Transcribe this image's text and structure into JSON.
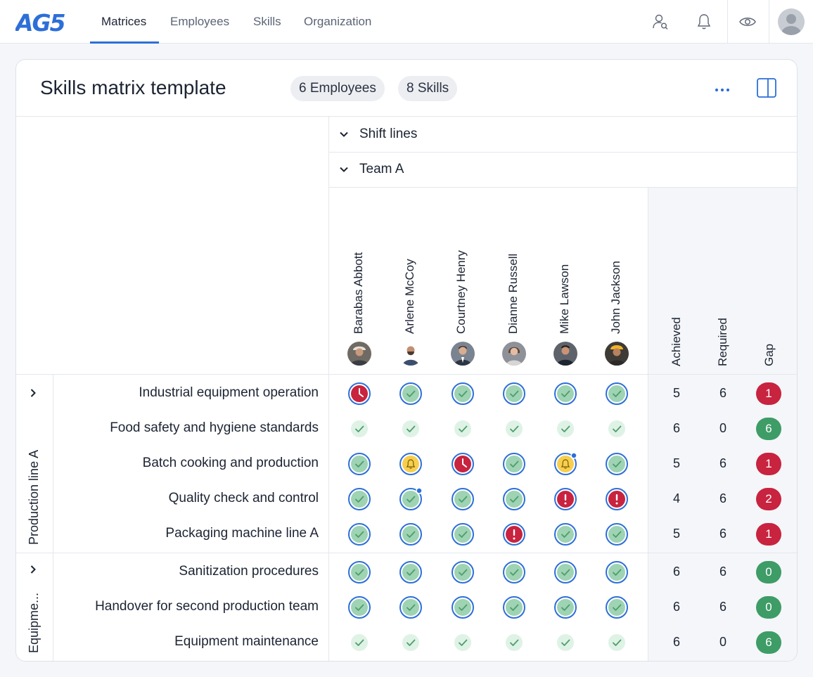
{
  "nav": {
    "logo": "AG5",
    "tabs": [
      {
        "label": "Matrices",
        "active": true
      },
      {
        "label": "Employees",
        "active": false
      },
      {
        "label": "Skills",
        "active": false
      },
      {
        "label": "Organization",
        "active": false
      }
    ],
    "icons": [
      "user-search-icon",
      "bell-icon",
      "eye-icon",
      "avatar"
    ]
  },
  "matrix": {
    "title": "Skills matrix template",
    "employees_pill": "6 Employees",
    "skills_pill": "8 Skills",
    "groups": [
      "Shift lines",
      "Team A"
    ],
    "employees": [
      "Barabas Abbott",
      "Arlene McCoy",
      "Courtney Henry",
      "Dianne Russell",
      "Mike Lawson",
      "John Jackson"
    ],
    "stat_headers": [
      "Achieved",
      "Required",
      "Gap"
    ],
    "row_groups": [
      {
        "label": "Production line A",
        "rows": [
          {
            "skill": "Industrial equipment operation",
            "cells": [
              "clock",
              "check",
              "check",
              "check",
              "check",
              "check"
            ],
            "achieved": "5",
            "required": "6",
            "gap": "1",
            "gap_status": "red"
          },
          {
            "skill": "Food safety and hygiene standards",
            "cells": [
              "plain",
              "plain",
              "plain",
              "plain",
              "plain",
              "plain"
            ],
            "achieved": "6",
            "required": "0",
            "gap": "6",
            "gap_status": "green"
          },
          {
            "skill": "Batch cooking and production",
            "cells": [
              "check",
              "bell",
              "clock",
              "check",
              "bell-dot",
              "check"
            ],
            "achieved": "5",
            "required": "6",
            "gap": "1",
            "gap_status": "red"
          },
          {
            "skill": "Quality check and control",
            "cells": [
              "check",
              "check-dot",
              "check",
              "check",
              "alert",
              "alert"
            ],
            "achieved": "4",
            "required": "6",
            "gap": "2",
            "gap_status": "red"
          },
          {
            "skill": "Packaging machine line A",
            "cells": [
              "check",
              "check",
              "check",
              "alert",
              "check",
              "check"
            ],
            "achieved": "5",
            "required": "6",
            "gap": "1",
            "gap_status": "red"
          }
        ]
      },
      {
        "label": "Equipme...",
        "rows": [
          {
            "skill": "Sanitization procedures",
            "cells": [
              "check",
              "check",
              "check",
              "check",
              "check",
              "check"
            ],
            "achieved": "6",
            "required": "6",
            "gap": "0",
            "gap_status": "green"
          },
          {
            "skill": "Handover for second production team",
            "cells": [
              "check",
              "check",
              "check",
              "check",
              "check",
              "check"
            ],
            "achieved": "6",
            "required": "6",
            "gap": "0",
            "gap_status": "green"
          },
          {
            "skill": "Equipment maintenance",
            "cells": [
              "plain",
              "plain",
              "plain",
              "plain",
              "plain",
              "plain"
            ],
            "achieved": "6",
            "required": "0",
            "gap": "6",
            "gap_status": "green"
          }
        ]
      }
    ]
  },
  "colors": {
    "accent": "#2d6fd8",
    "check_fill": "#9ed3b3",
    "plain_fill": "#dff2e6",
    "alert_red": "#c8233f",
    "bell_yellow": "#f7cf4f",
    "gap_red": "#c8233f",
    "gap_green": "#3e9c66"
  }
}
